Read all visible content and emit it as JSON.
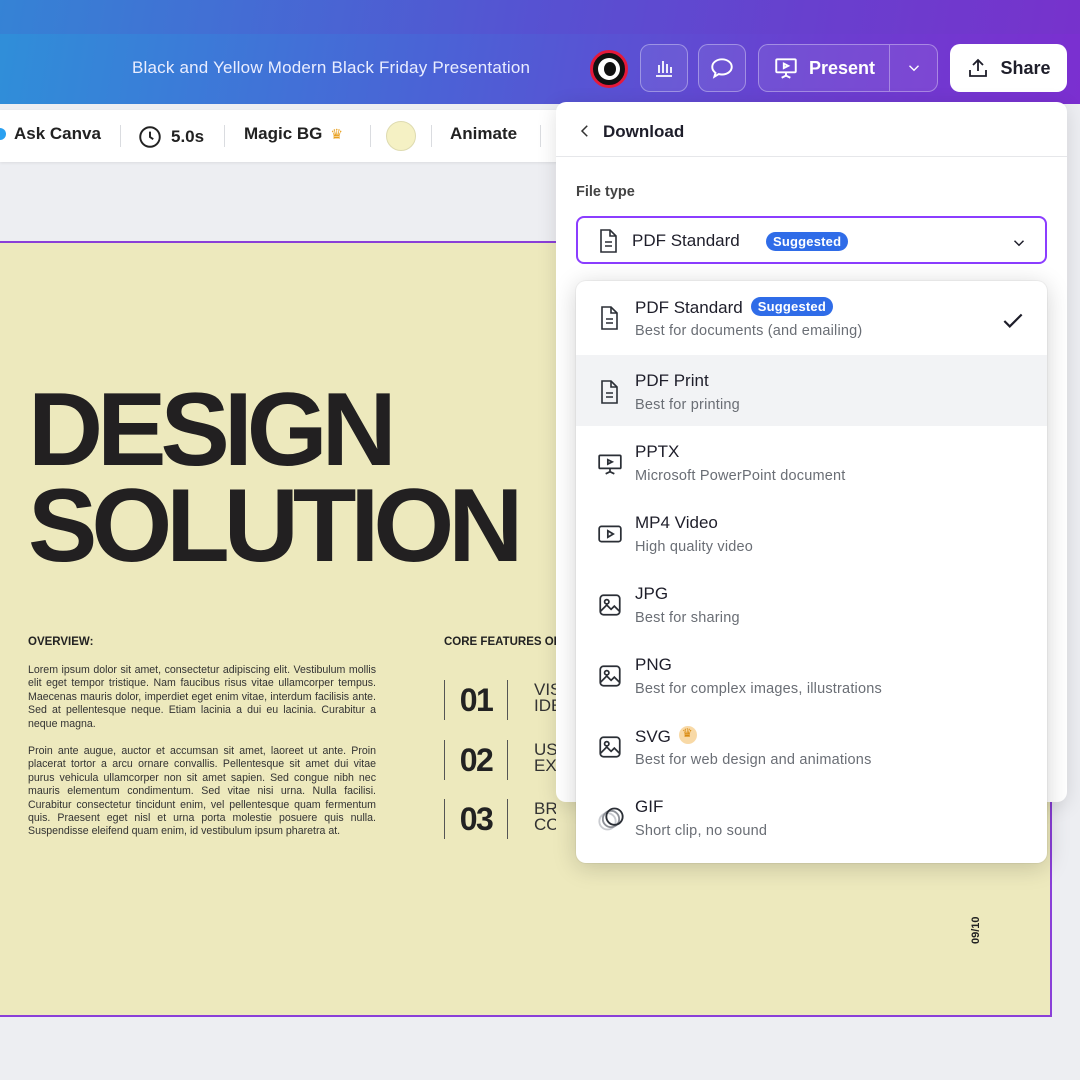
{
  "header": {
    "doc_title": "Black and Yellow Modern Black Friday Presentation",
    "present_label": "Present",
    "share_label": "Share"
  },
  "toolbar": {
    "ask_canva": "Ask Canva",
    "duration": "5.0s",
    "magic_bg": "Magic BG",
    "animate": "Animate"
  },
  "slide": {
    "title_line1": "DESIGN",
    "title_line2": "SOLUTION",
    "overview_heading": "OVERVIEW:",
    "overview_p1": "Lorem ipsum dolor sit amet, consectetur adipiscing elit. Vestibulum mollis elit eget tempor tristique. Nam faucibus risus vitae ullamcorper tempus. Maecenas mauris dolor, imperdiet eget enim vitae, interdum facilisis ante. Sed at pellentesque neque. Etiam lacinia a dui eu lacinia. Curabitur a neque magna.",
    "overview_p2": "Proin ante augue, auctor et accumsan sit amet, laoreet ut ante. Proin placerat tortor a arcu ornare convallis. Pellentesque sit amet dui vitae purus vehicula ullamcorper non sit amet sapien. Sed congue nibh nec mauris elementum condimentum. Sed vitae nisi urna. Nulla facilisi. Curabitur consectetur tincidunt enim, vel pellentesque quam fermentum quis. Praesent eget nisl et urna porta molestie posuere quis nulla. Suspendisse eleifend quam enim, id vestibulum ipsum pharetra at.",
    "core_heading": "CORE FEATURES OF",
    "features": [
      {
        "num": "01",
        "label": "VIS\nIDE"
      },
      {
        "num": "02",
        "label": "US\nEX"
      },
      {
        "num": "03",
        "label": "BRA\nCONS"
      }
    ],
    "page_number": "09/10"
  },
  "download": {
    "title": "Download",
    "file_type_label": "File type",
    "selected_value": "PDF Standard",
    "suggested_badge": "Suggested",
    "options": [
      {
        "name": "PDF Standard",
        "desc": "Best for documents (and emailing)",
        "icon": "document-icon"
      },
      {
        "name": "PDF Print",
        "desc": "Best for printing",
        "icon": "document-icon"
      },
      {
        "name": "PPTX",
        "desc": "Microsoft PowerPoint document",
        "icon": "presentation-icon"
      },
      {
        "name": "MP4 Video",
        "desc": "High quality video",
        "icon": "video-icon"
      },
      {
        "name": "JPG",
        "desc": "Best for sharing",
        "icon": "image-icon"
      },
      {
        "name": "PNG",
        "desc": "Best for complex images, illustrations",
        "icon": "image-icon"
      },
      {
        "name": "SVG",
        "desc": "Best for web design and animations",
        "icon": "image-icon"
      },
      {
        "name": "GIF",
        "desc": "Short clip, no sound",
        "icon": "gif-icon"
      }
    ]
  },
  "colors": {
    "accent": "#8b3dff",
    "badge": "#2f6ce8",
    "slide_bg": "#ede9bd"
  }
}
